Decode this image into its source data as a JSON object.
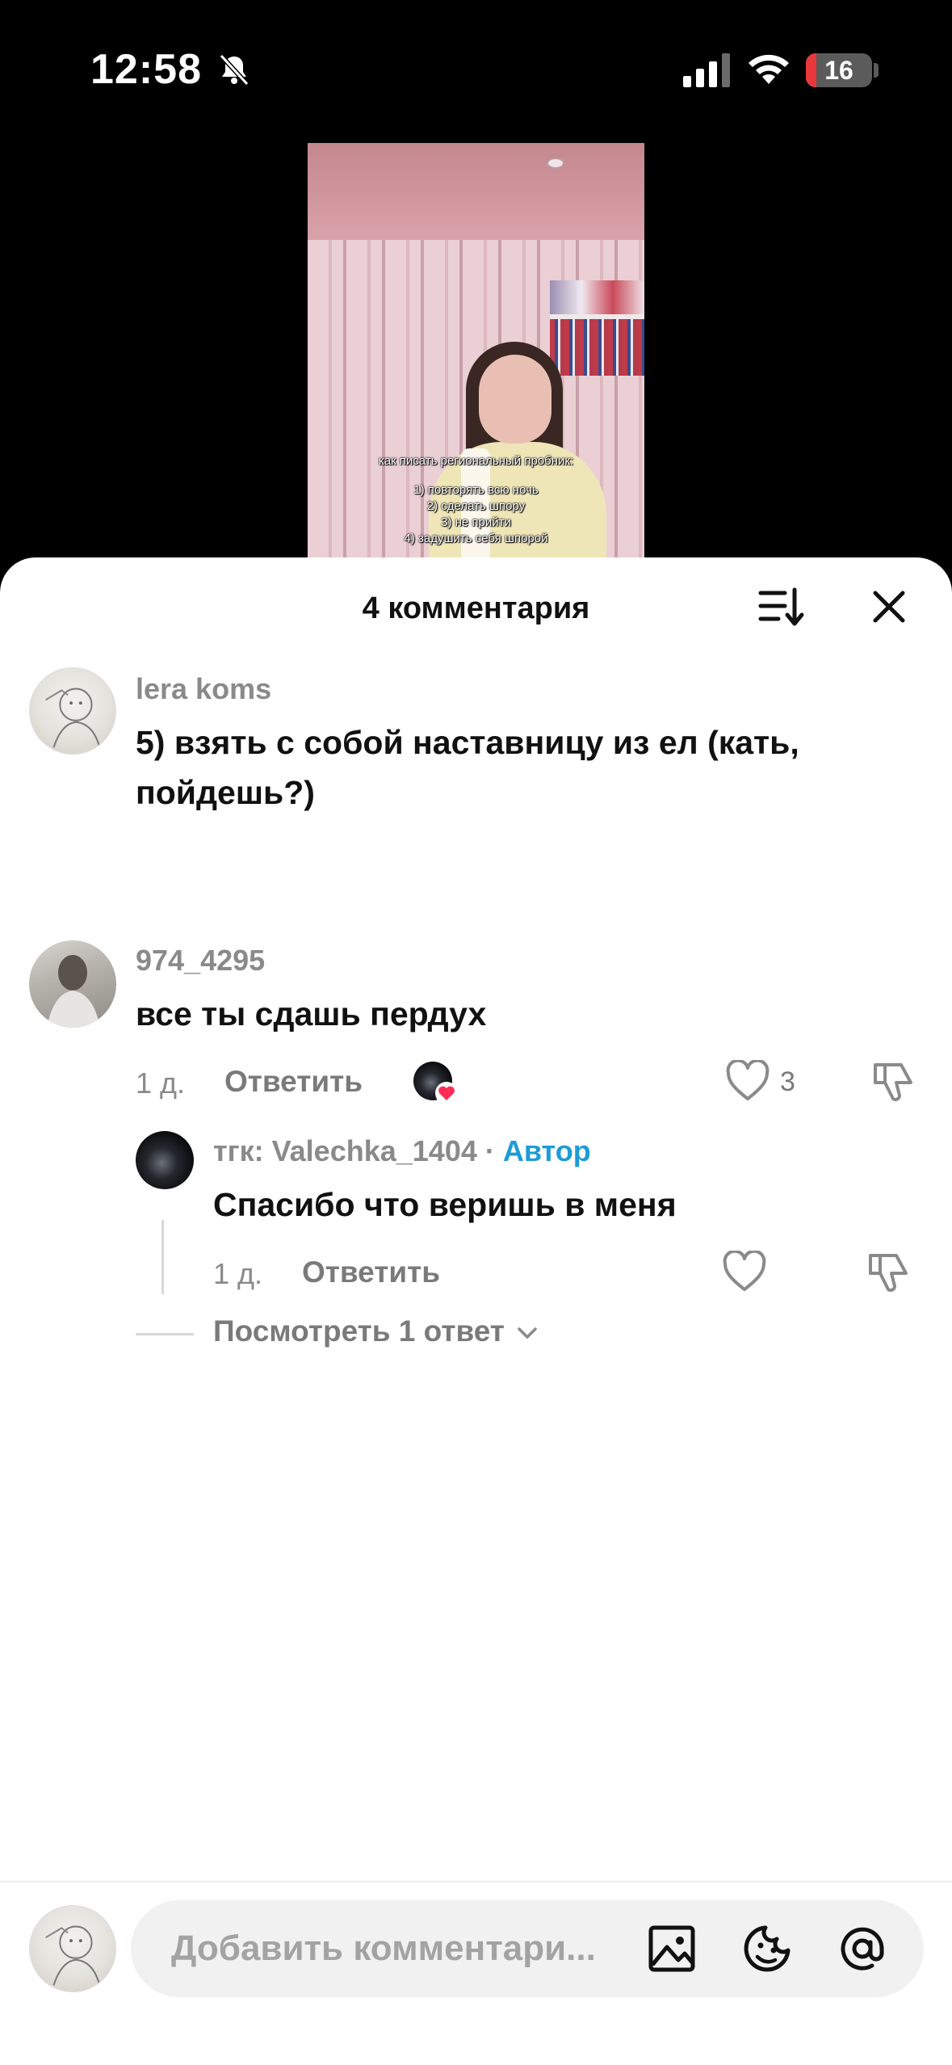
{
  "status_bar": {
    "time": "12:58",
    "battery_level": "16",
    "icons": [
      "bell-slash-icon",
      "cellular-signal-icon",
      "wifi-icon",
      "battery-icon"
    ]
  },
  "video": {
    "overlay_title": "как писать региональный пробник:",
    "overlay_items": [
      "1) повторять всю ночь",
      "2) сделать шпору",
      "3) не прийти",
      "4) задушить себя шпорой"
    ]
  },
  "sheet": {
    "title": "4 комментария",
    "sort_icon": "sort-icon",
    "close_icon": "close-icon"
  },
  "comments": [
    {
      "username": "lera koms",
      "text": "5) взять с собой наставницу из ел (кать, пойдешь?)"
    },
    {
      "username": "974_4295",
      "text": "все ты сдашь пердух",
      "time": "1 д.",
      "reply_label": "Ответить",
      "likes": "3"
    }
  ],
  "reply": {
    "username": "тгк: Valechka_1404",
    "separator": "·",
    "author_tag": "Автор",
    "text": "Спасибо что веришь в меня",
    "time": "1 д.",
    "reply_label": "Ответить"
  },
  "view_replies": "Посмотреть 1 ответ",
  "composer": {
    "placeholder": "Добавить комментари...",
    "icons": [
      "image-icon",
      "sticker-icon",
      "mention-icon"
    ]
  },
  "colors": {
    "author_accent": "#1d9bd6",
    "muted_text": "#8a8a8a",
    "like_badge": "#fe2c55"
  }
}
